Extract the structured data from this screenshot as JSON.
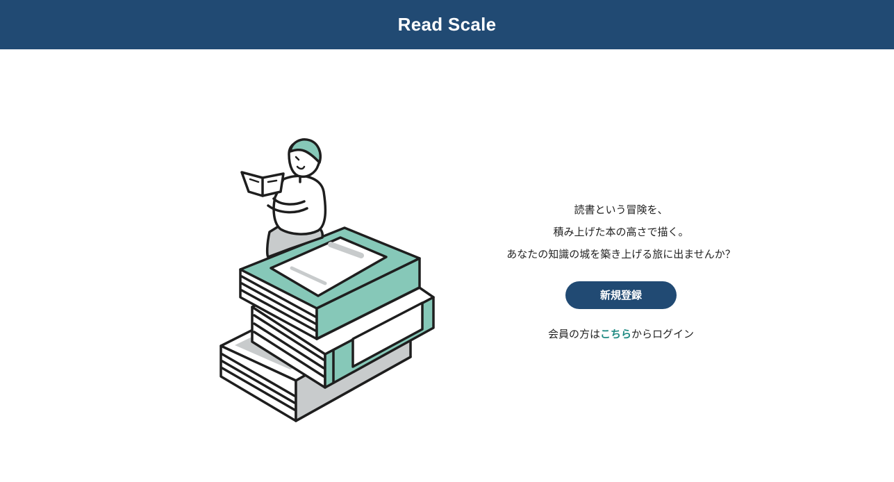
{
  "header": {
    "title": "Read Scale"
  },
  "hero": {
    "tagline_lines": [
      "読書という冒険を、",
      "積み上げた本の高さで描く。",
      "あなたの知識の城を築き上げる旅に出ませんか？"
    ],
    "signup_label": "新規登録",
    "login_prefix": "会員の方は",
    "login_link": "こちら",
    "login_suffix": "からログイン"
  },
  "colors": {
    "header_bg": "#214a73",
    "button_bg": "#214a73",
    "link": "#1f8a82",
    "illustration_accent": "#86c8b8",
    "illustration_shadow": "#c8cbcc"
  },
  "illustration": {
    "subject": "person-reading-on-book-stack"
  }
}
